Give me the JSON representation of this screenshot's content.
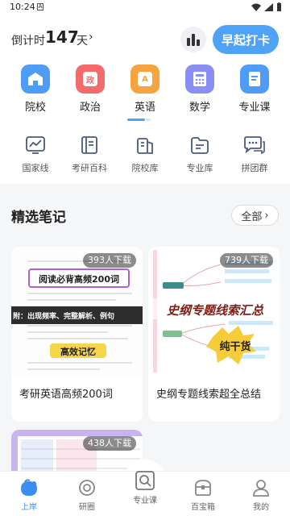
{
  "status_bar": {
    "time": "10:24",
    "sim_glyph": "A"
  },
  "header": {
    "countdown_label": "倒计时",
    "countdown_days": "147",
    "countdown_unit": "天",
    "checkin_label": "早起打卡"
  },
  "subjects": [
    {
      "label": "院校",
      "icon": "school-icon",
      "color": "#4e9cf5",
      "glyph": ""
    },
    {
      "label": "政治",
      "icon": "politics-icon",
      "color": "#f46b6b",
      "glyph": "政"
    },
    {
      "label": "英语",
      "icon": "english-icon",
      "color": "#f7a440",
      "glyph": "A"
    },
    {
      "label": "数学",
      "icon": "calculator-icon",
      "color": "#8a8ff5",
      "glyph": ""
    },
    {
      "label": "专业课",
      "icon": "book-icon",
      "color": "#4e9cf5",
      "glyph": ""
    }
  ],
  "selected_subject": "英语",
  "tools": [
    {
      "label": "国家线",
      "icon": "chart-line-icon"
    },
    {
      "label": "考研百科",
      "icon": "encyclopedia-icon"
    },
    {
      "label": "院校库",
      "icon": "school-library-icon"
    },
    {
      "label": "专业库",
      "icon": "folder-icon"
    },
    {
      "label": "拼团群",
      "icon": "chat-group-icon"
    }
  ],
  "notes_section": {
    "title": "精选笔记",
    "all_label": "全部"
  },
  "notes": [
    {
      "title": "考研英语高频200词",
      "downloads": "393人下载",
      "thumb_heading": "阅读必背高频200词",
      "thumb_banner": "附：出现频率、完整解析、例句",
      "thumb_footer": "高效记忆"
    },
    {
      "title": "史纲专题线索超全总结",
      "downloads": "739人下载",
      "thumb_heading": "史纲专题线索汇总",
      "thumb_badge": "纯干货"
    },
    {
      "downloads": "438人下载"
    }
  ],
  "bottom_nav": [
    {
      "label": "上岸",
      "icon": "home-icon",
      "active": true
    },
    {
      "label": "研圈",
      "icon": "circle-icon",
      "active": false
    },
    {
      "label": "专业课",
      "icon": "search-book-icon",
      "active": false
    },
    {
      "label": "百宝箱",
      "icon": "toolbox-icon",
      "active": false
    },
    {
      "label": "我的",
      "icon": "profile-icon",
      "active": false
    }
  ],
  "colors": {
    "accent": "#4fa3f7",
    "active_nav": "#3a8ef2"
  }
}
